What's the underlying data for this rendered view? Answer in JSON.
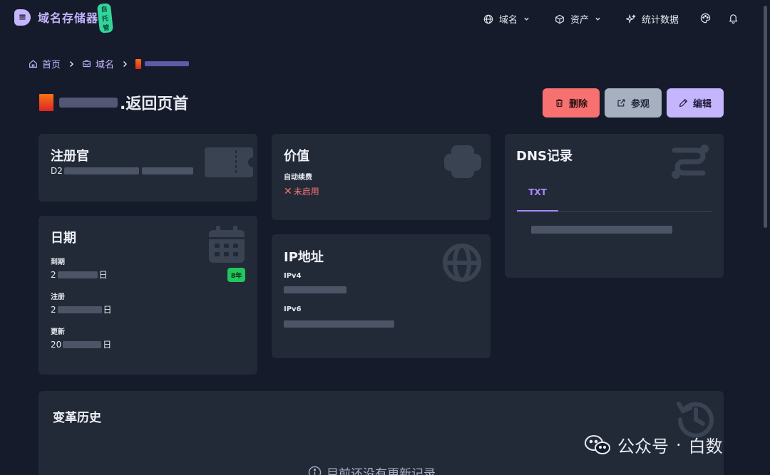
{
  "app": {
    "name": "域名存储器",
    "badge": "自托管"
  },
  "nav": {
    "domains": "域名",
    "assets": "资产",
    "stats": "统计数据"
  },
  "breadcrumb": {
    "home": "首页",
    "domains": "域名"
  },
  "page": {
    "title_suffix": ".返回页首"
  },
  "actions": {
    "delete": "删除",
    "view": "参观",
    "edit": "编辑"
  },
  "registrar": {
    "title": "注册官",
    "value_prefix": "D2"
  },
  "value_card": {
    "title": "价值",
    "auto_renew_label": "自动续费",
    "auto_renew_status": "未启用"
  },
  "dns": {
    "title": "DNS记录",
    "tab": "TXT"
  },
  "dates": {
    "title": "日期",
    "expiry_label": "到期",
    "expiry_prefix": "2",
    "expiry_suffix": "日",
    "register_label": "注册",
    "register_prefix": "2",
    "register_suffix": "日",
    "update_label": "更新",
    "update_prefix": "20",
    "update_suffix": "日",
    "years_badge": "8年"
  },
  "ip": {
    "title": "IP地址",
    "ipv4_label": "IPv4",
    "ipv6_label": "IPv6"
  },
  "history": {
    "title": "变革历史",
    "empty": "目前还没有更新记录"
  },
  "watermark": {
    "left": "公众号",
    "sep": "·",
    "right": "白数"
  },
  "colors": {
    "background": "#151b2b",
    "card": "#222a38",
    "accent": "#c4b5fd",
    "danger": "#f87171",
    "success": "#22c55e"
  }
}
